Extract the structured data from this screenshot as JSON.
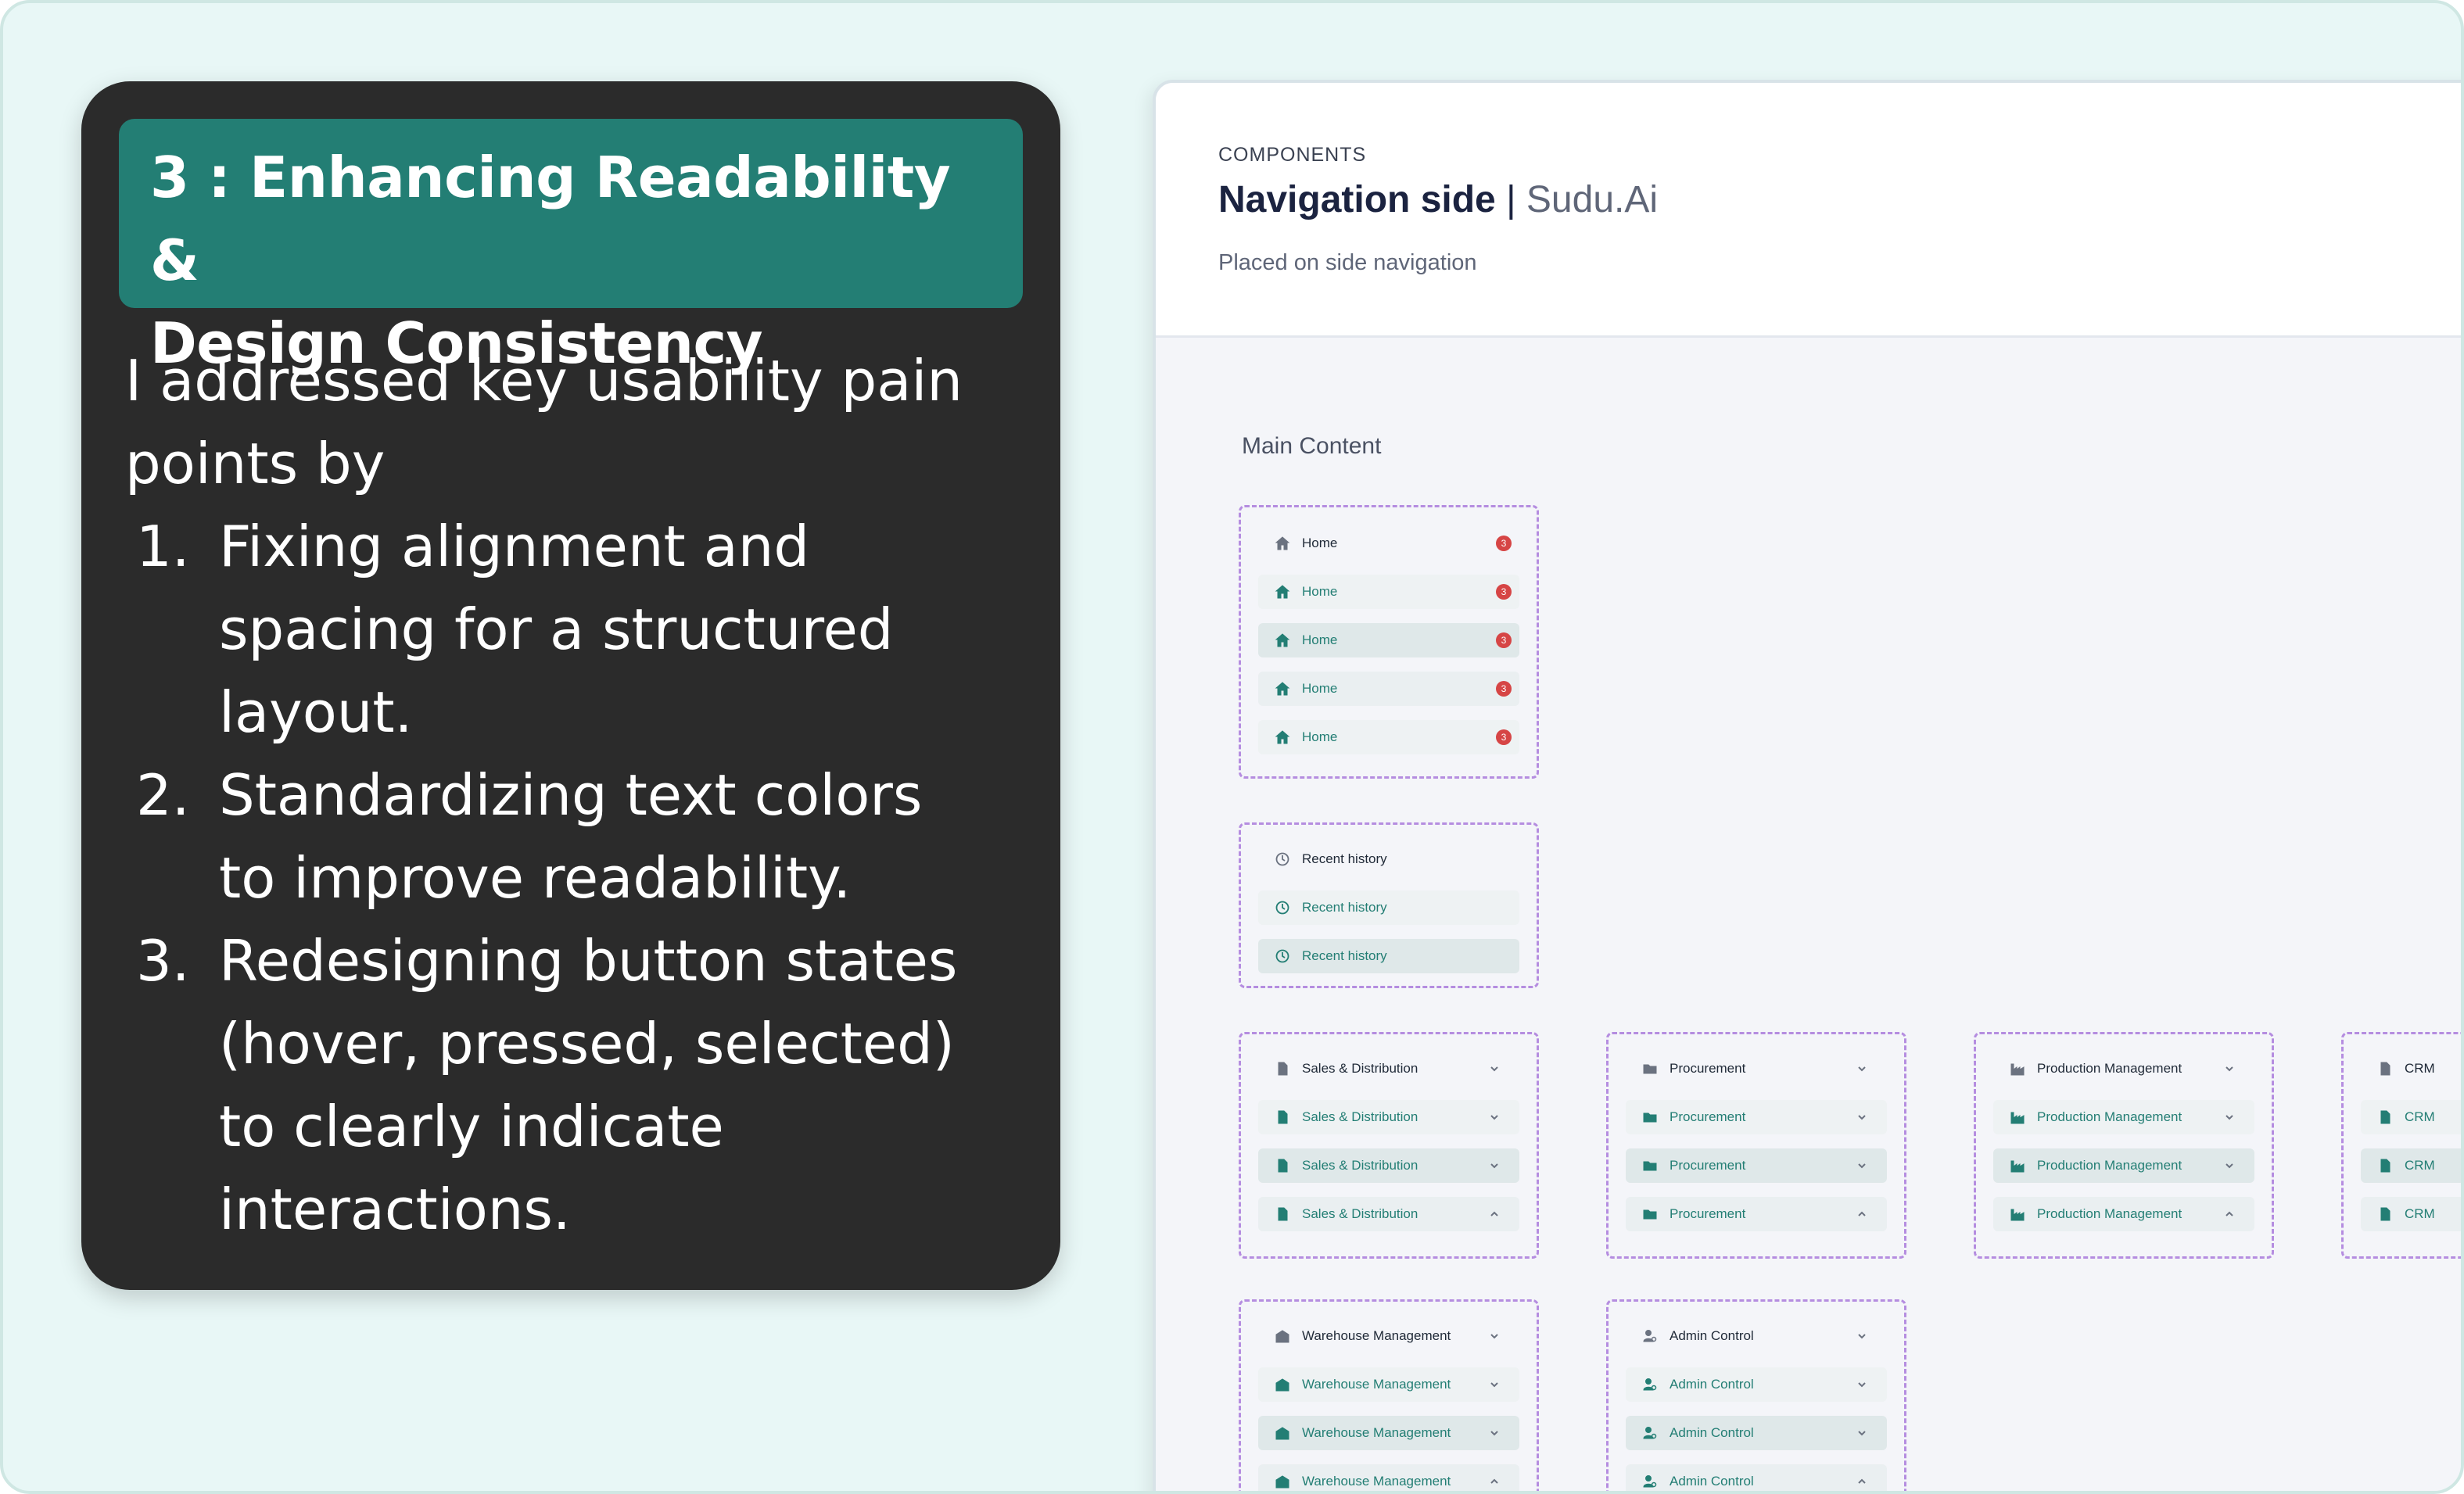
{
  "card": {
    "title_line1": "3 : Enhancing Readability &",
    "title_line2": "Design Consistency",
    "intro_line1": "I addressed key usability pain",
    "intro_line2": "points by",
    "steps": [
      {
        "num": "1.",
        "lines": [
          "Fixing alignment and",
          "spacing for a structured",
          "layout."
        ]
      },
      {
        "num": "2.",
        "lines": [
          "Standardizing text colors",
          "to improve readability."
        ]
      },
      {
        "num": "3.",
        "lines": [
          "Redesigning button states",
          "(hover, pressed, selected)",
          "to clearly indicate",
          "interactions."
        ]
      }
    ]
  },
  "panel": {
    "eyebrow": "COMPONENTS",
    "title_strong": "Navigation side",
    "title_sep": "|",
    "title_light": "Sudu.Ai",
    "subtitle": "Placed on side navigation",
    "main_label": "Main Content"
  },
  "groups": {
    "home": {
      "label": "Home",
      "badge": "3",
      "icon": "home-icon"
    },
    "recent": {
      "label": "Recent history",
      "icon": "history-icon"
    },
    "sales": {
      "label": "Sales & Distribution",
      "icon": "document-icon"
    },
    "procurement": {
      "label": "Procurement",
      "icon": "folder-icon"
    },
    "production": {
      "label": "Production Management",
      "icon": "factory-icon"
    },
    "crm": {
      "label": "CRM",
      "icon": "document-icon"
    },
    "warehouse": {
      "label": "Warehouse Management",
      "icon": "warehouse-icon"
    },
    "admin": {
      "label": "Admin Control",
      "icon": "admin-user-icon"
    }
  },
  "colors": {
    "title_bg": "#237e74",
    "card_bg": "#2b2b2b",
    "accent": "#237e74",
    "badge": "#d64545",
    "dashed_border": "#b58de0"
  }
}
